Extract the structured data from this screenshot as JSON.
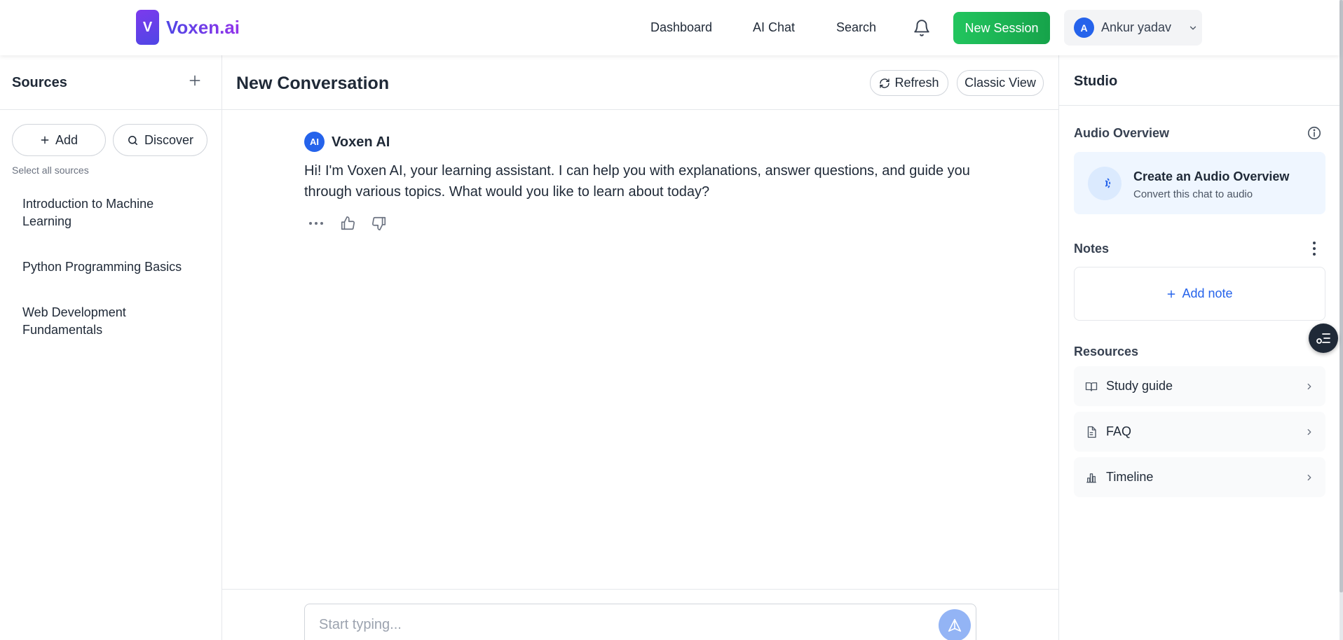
{
  "header": {
    "logo_letter": "V",
    "brand": "Voxen.ai",
    "nav": [
      "Dashboard",
      "AI Chat",
      "Search"
    ],
    "new_session": "New Session",
    "user": {
      "initial": "A",
      "name": "Ankur yadav"
    }
  },
  "sources": {
    "title": "Sources",
    "add_label": "Add",
    "discover_label": "Discover",
    "select_all": "Select all sources",
    "items": [
      "Introduction to Machine Learning",
      "Python Programming Basics",
      "Web Development Fundamentals"
    ]
  },
  "conversation": {
    "title": "New Conversation",
    "refresh_label": "Refresh",
    "classic_view_label": "Classic View",
    "assistant_badge": "AI",
    "assistant_name": "Voxen AI",
    "message": "Hi! I'm Voxen AI, your learning assistant. I can help you with explanations, answer questions, and guide you through various topics. What would you like to learn about today?",
    "composer_placeholder": "Start typing..."
  },
  "studio": {
    "title": "Studio",
    "audio_overview_title": "Audio Overview",
    "audio_card_title": "Create an Audio Overview",
    "audio_card_sub": "Convert this chat to audio",
    "notes_title": "Notes",
    "add_note_label": "Add note",
    "resources_title": "Resources",
    "resources": [
      {
        "label": "Study guide",
        "icon": "book-icon"
      },
      {
        "label": "FAQ",
        "icon": "document-icon"
      },
      {
        "label": "Timeline",
        "icon": "bar-chart-icon"
      }
    ]
  },
  "colors": {
    "brand": "#4f46e5",
    "accent_green": "#16a34a",
    "primary_blue": "#2563eb"
  }
}
